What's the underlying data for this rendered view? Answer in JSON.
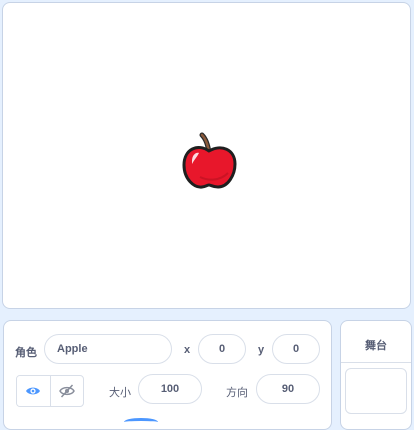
{
  "sprite_info": {
    "sprite_label": "角色",
    "name_value": "Apple",
    "x_label": "x",
    "x_value": "0",
    "y_label": "y",
    "y_value": "0",
    "size_label": "大小",
    "size_value": "100",
    "direction_label": "方向",
    "direction_value": "90",
    "show_icon": "eye-icon",
    "hide_icon": "eye-slash-icon"
  },
  "stage_panel": {
    "title": "舞台"
  },
  "colors": {
    "background": "#e5f0fe",
    "accent": "#4c97ff",
    "text": "#575e75",
    "apple_red": "#e8172b"
  }
}
